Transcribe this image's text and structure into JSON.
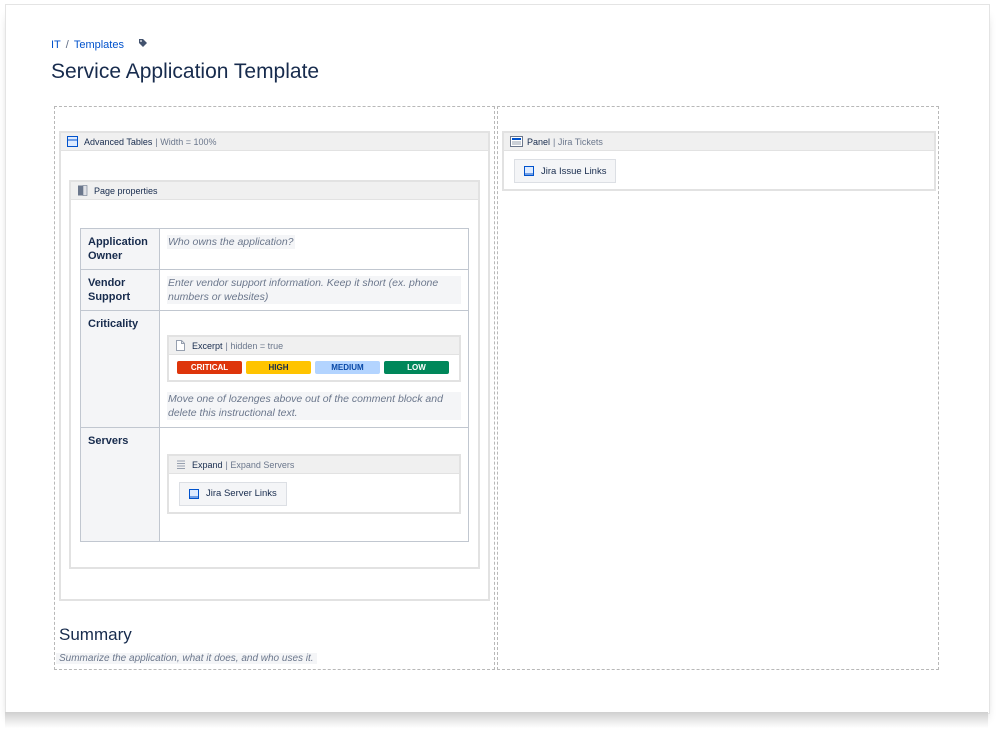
{
  "breadcrumb": {
    "items": [
      "IT",
      "Templates"
    ],
    "separator": "/"
  },
  "page_title": "Service Application Template",
  "left_column": {
    "advanced_tables": {
      "name": "Advanced Tables",
      "param": "| Width = 100%"
    },
    "page_properties": {
      "name": "Page properties",
      "rows": [
        {
          "header": "Application Owner",
          "placeholder": "Who owns the application?"
        },
        {
          "header": "Vendor Support",
          "placeholder": "Enter vendor support information. Keep it short (ex. phone numbers or websites)"
        },
        {
          "header": "Criticality",
          "instruction": "Move one of lozenges above out of the comment block and delete this instructional text."
        },
        {
          "header": "Servers"
        }
      ]
    },
    "excerpt": {
      "name": "Excerpt",
      "param": "| hidden = true",
      "lozenges": [
        {
          "label": "CRITICAL",
          "bg": "#de350b",
          "fg": "#ffffff"
        },
        {
          "label": "HIGH",
          "bg": "#ffc400",
          "fg": "#172b4d"
        },
        {
          "label": "MEDIUM",
          "bg": "#b3d4ff",
          "fg": "#0747a6"
        },
        {
          "label": "LOW",
          "bg": "#00875a",
          "fg": "#ffffff"
        }
      ]
    },
    "expand": {
      "name": "Expand",
      "param": "| Expand Servers",
      "button": "Jira Server Links"
    },
    "summary": {
      "heading": "Summary",
      "placeholder": "Summarize the application, what it does, and who uses it."
    }
  },
  "right_column": {
    "panel": {
      "name": "Panel",
      "param": "| Jira Tickets",
      "button": "Jira Issue Links"
    }
  },
  "colors": {
    "link": "#0052cc",
    "text": "#172b4d",
    "muted": "#6b778c"
  }
}
